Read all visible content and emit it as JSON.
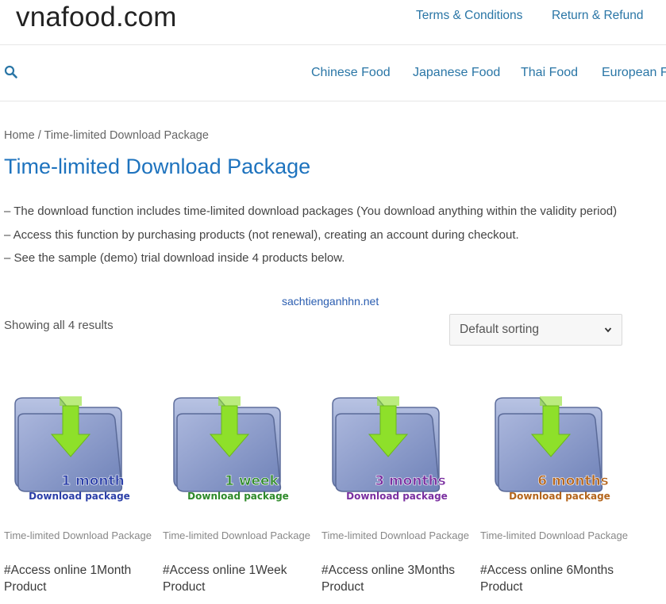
{
  "site": {
    "title": "vnafood.com"
  },
  "top_links": [
    {
      "label": "Terms & Conditions"
    },
    {
      "label": "Return & Refund"
    }
  ],
  "nav": {
    "search_icon": "search-icon",
    "items": [
      {
        "label": "Chinese Food"
      },
      {
        "label": "Japanese Food"
      },
      {
        "label": "Thai Food"
      },
      {
        "label": "European Fo"
      }
    ]
  },
  "breadcrumb": {
    "home": "Home",
    "separator": " / ",
    "current": "Time-limited Download Package"
  },
  "page": {
    "title": "Time-limited Download Package",
    "description": [
      "– The download function includes time-limited download packages (You download anything within the validity period)",
      "– Access this function by purchasing products (not renewal), creating an account during checkout.",
      "– See the sample (demo) trial download inside 4 products below."
    ]
  },
  "watermark": "sachtienganhhn.net",
  "shop": {
    "results_count": "Showing all 4 results",
    "sort_selected": "Default sorting"
  },
  "products": [
    {
      "category": "Time-limited Download Package",
      "name": "#Access online 1Month Product",
      "label_top": "1 month",
      "label_bottom": "Download package",
      "label_top_color": "#2b3fa8",
      "label_bottom_color": "#2b3fa8"
    },
    {
      "category": "Time-limited Download Package",
      "name": "#Access online 1Week Product",
      "label_top": "1 week",
      "label_bottom": "Download package",
      "label_top_color": "#2e8a2a",
      "label_bottom_color": "#2e8a2a"
    },
    {
      "category": "Time-limited Download Package",
      "name": "#Access online 3Months Product",
      "label_top": "3 months",
      "label_bottom": "Download package",
      "label_top_color": "#7a2fa0",
      "label_bottom_color": "#7a2fa0"
    },
    {
      "category": "Time-limited Download Package",
      "name": "#Access online 6Months Product",
      "label_top": "6 months",
      "label_bottom": "Download package",
      "label_top_color": "#b4651c",
      "label_bottom_color": "#b4651c"
    }
  ],
  "colors": {
    "link": "#2a76a6",
    "title": "#1e73be",
    "folder": "#8f9fc9",
    "arrow": "#8ee02a"
  }
}
